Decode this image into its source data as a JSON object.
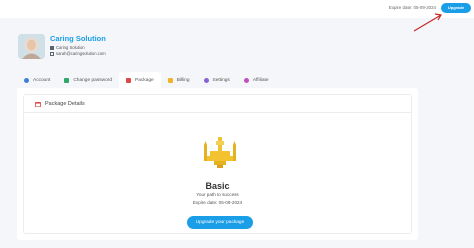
{
  "header": {
    "expire_text": "Expire date: 05-09-2024",
    "upgrade_label": "Upgrade"
  },
  "profile": {
    "name": "Caring Solution",
    "company": "Caring Solution",
    "email": "sarah@caringsolution.com"
  },
  "tabs": [
    {
      "label": "Account",
      "icon": "user-icon",
      "active": false
    },
    {
      "label": "Change password",
      "icon": "key-icon",
      "active": false
    },
    {
      "label": "Package",
      "icon": "calendar-icon",
      "active": true
    },
    {
      "label": "Billing",
      "icon": "bill-icon",
      "active": false
    },
    {
      "label": "Settings",
      "icon": "gear-icon",
      "active": false
    },
    {
      "label": "Affiliate",
      "icon": "affiliate-icon",
      "active": false
    }
  ],
  "package": {
    "section_title": "Package Details",
    "plan_name": "Basic",
    "tagline": "Your path to success",
    "expire_text": "Expire date: 05-09-2024",
    "upgrade_label": "Upgrade your package"
  },
  "colors": {
    "accent": "#1a9ee8",
    "arrow": "#c62828",
    "plane": "#f2c230"
  }
}
